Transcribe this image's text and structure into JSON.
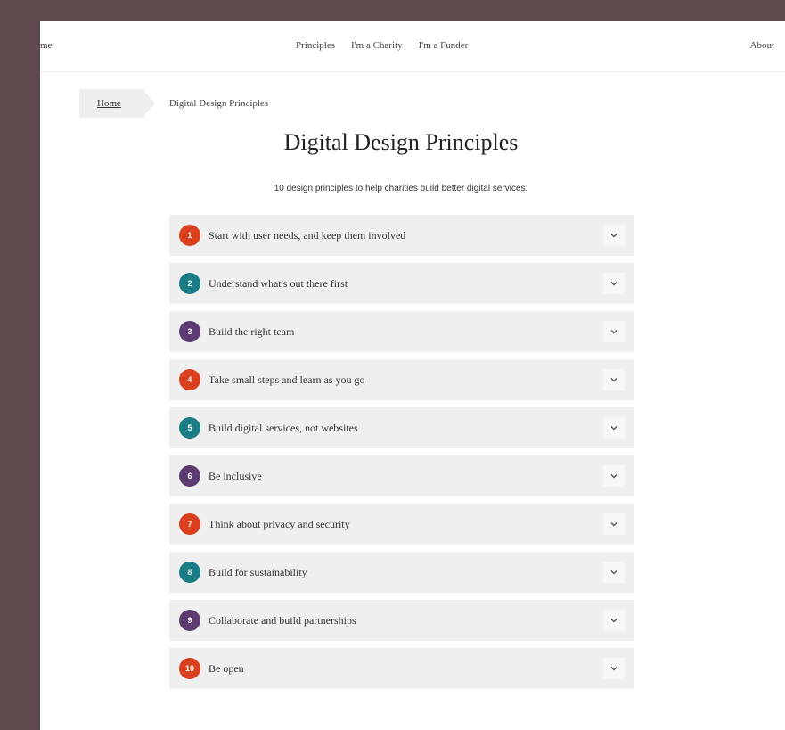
{
  "nav": {
    "left_partial": "me",
    "links": [
      "Principles",
      "I'm a Charity",
      "I'm a Funder"
    ],
    "about": "About"
  },
  "breadcrumb": {
    "home": "Home",
    "current": "Digital Design Principles"
  },
  "page": {
    "title": "Digital Design Principles",
    "subtitle": "10 design principles to help charities build better digital services:"
  },
  "colors": {
    "orange": "#d9401e",
    "teal": "#1a7d86",
    "purple": "#5d3a6f"
  },
  "principles": [
    {
      "number": "1",
      "text": "Start with user needs, and keep them involved",
      "color": "#d9401e"
    },
    {
      "number": "2",
      "text": "Understand what's out there first",
      "color": "#1a7d86"
    },
    {
      "number": "3",
      "text": "Build the right team",
      "color": "#5d3a6f"
    },
    {
      "number": "4",
      "text": "Take small steps and learn as you go",
      "color": "#d9401e"
    },
    {
      "number": "5",
      "text": "Build digital services, not websites",
      "color": "#1a7d86"
    },
    {
      "number": "6",
      "text": "Be inclusive",
      "color": "#5d3a6f"
    },
    {
      "number": "7",
      "text": "Think about privacy and security",
      "color": "#d9401e"
    },
    {
      "number": "8",
      "text": "Build for sustainability",
      "color": "#1a7d86"
    },
    {
      "number": "9",
      "text": "Collaborate and build partnerships",
      "color": "#5d3a6f"
    },
    {
      "number": "10",
      "text": "Be open",
      "color": "#d9401e"
    }
  ],
  "icons": {
    "expand": "chevron-down-icon"
  }
}
